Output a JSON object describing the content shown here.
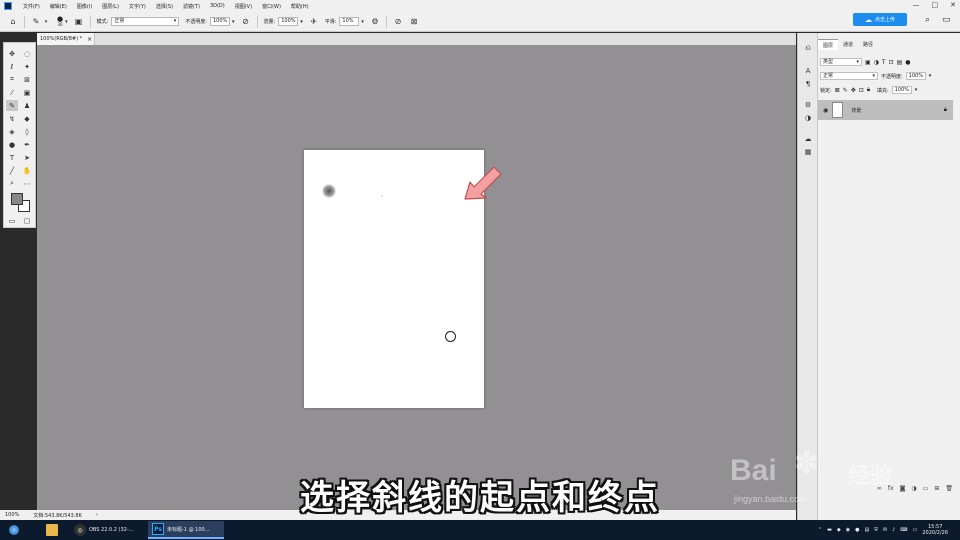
{
  "menubar": {
    "items": [
      "文件(F)",
      "编辑(E)",
      "图像(I)",
      "图层(L)",
      "文字(Y)",
      "选择(S)",
      "滤镜(T)",
      "3D(D)",
      "视图(V)",
      "窗口(W)",
      "帮助(H)"
    ],
    "window_controls": [
      "—",
      "□",
      "✕"
    ]
  },
  "options": {
    "brush_size": "30",
    "mode_label": "模式:",
    "mode_value": "正常",
    "opacity_label": "不透明度:",
    "opacity_value": "100%",
    "flow_label": "流量:",
    "flow_value": "100%",
    "smooth_label": "平滑:",
    "smooth_value": "10%",
    "share_label": "点击上传"
  },
  "document": {
    "tab_label": "100%(RGB/8#) *",
    "tab_close": "×"
  },
  "status": {
    "zoom": "100%",
    "doc_info": "文档:543.8K/543.8K"
  },
  "layers_panel": {
    "tabs": [
      "图层",
      "通道",
      "路径"
    ],
    "filter_label": "类型",
    "blend_mode": "正常",
    "opacity_label": "不透明度:",
    "opacity_value": "100%",
    "lock_label": "锁定:",
    "fill_label": "填充:",
    "fill_value": "100%",
    "layer_name": "背景"
  },
  "taskbar": {
    "obs_label": "OBS 22.0.2 (32-...",
    "ps_label": "未标题-1 @ 100...",
    "time": "15:57",
    "date": "2020/2/26"
  },
  "caption": {
    "text": "选择斜线的起点和终点"
  },
  "watermark": {
    "brand": "Bai",
    "brand_cn": "经验",
    "url": "jingyan.baidu.com"
  },
  "colors": {
    "canvas_bg": "#929093",
    "arrow": "#f4a0a0",
    "share_button": "#1c8dee",
    "taskbar": "#0c1a2e"
  }
}
